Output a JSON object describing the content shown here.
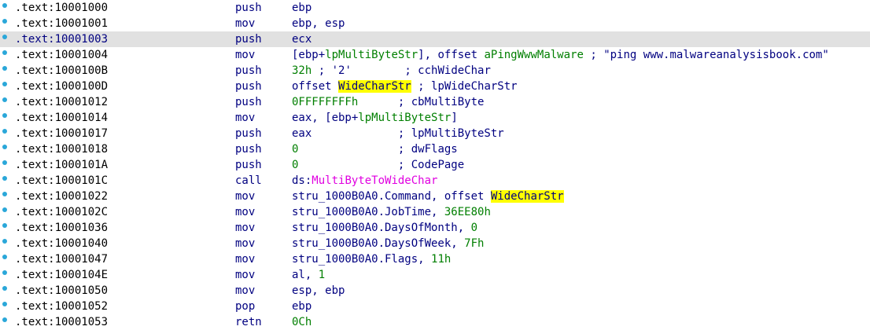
{
  "rows": [
    {
      "address": ".text:10001000",
      "mnemonic": "push",
      "operands": [
        {
          "text": "ebp",
          "cls": ""
        }
      ]
    },
    {
      "address": ".text:10001001",
      "mnemonic": "mov",
      "operands": [
        {
          "text": "ebp, esp",
          "cls": ""
        }
      ]
    },
    {
      "address": ".text:10001003",
      "mnemonic": "push",
      "selected": true,
      "operands": [
        {
          "text": "ecx",
          "cls": ""
        }
      ]
    },
    {
      "address": ".text:10001004",
      "mnemonic": "mov",
      "operands": [
        {
          "text": "[ebp+",
          "cls": ""
        },
        {
          "text": "lpMultiByteStr",
          "cls": "lbl"
        },
        {
          "text": "], offset ",
          "cls": ""
        },
        {
          "text": "aPingWwwMalware",
          "cls": "lbl"
        },
        {
          "text": " ; ",
          "cls": ""
        },
        {
          "text": "\"ping www.malwareanalysisbook.com\"",
          "cls": "str"
        }
      ]
    },
    {
      "address": ".text:1000100B",
      "mnemonic": "push",
      "operands": [
        {
          "text": "32h",
          "cls": "lbl"
        },
        {
          "text": " ; ",
          "cls": ""
        },
        {
          "text": "'2'",
          "cls": "str"
        },
        {
          "text": "        ; cchWideChar",
          "cls": ""
        }
      ]
    },
    {
      "address": ".text:1000100D",
      "mnemonic": "push",
      "operands": [
        {
          "text": "offset ",
          "cls": ""
        },
        {
          "text": "WideCharStr",
          "cls": "hl"
        },
        {
          "text": " ; lpWideCharStr",
          "cls": ""
        }
      ]
    },
    {
      "address": ".text:10001012",
      "mnemonic": "push",
      "operands": [
        {
          "text": "0FFFFFFFFh",
          "cls": "lbl"
        },
        {
          "text": "      ; cbMultiByte",
          "cls": ""
        }
      ]
    },
    {
      "address": ".text:10001014",
      "mnemonic": "mov",
      "operands": [
        {
          "text": "eax, [ebp+",
          "cls": ""
        },
        {
          "text": "lpMultiByteStr",
          "cls": "lbl"
        },
        {
          "text": "]",
          "cls": ""
        }
      ]
    },
    {
      "address": ".text:10001017",
      "mnemonic": "push",
      "operands": [
        {
          "text": "eax             ; lpMultiByteStr",
          "cls": ""
        }
      ]
    },
    {
      "address": ".text:10001018",
      "mnemonic": "push",
      "operands": [
        {
          "text": "0",
          "cls": "lbl"
        },
        {
          "text": "               ; dwFlags",
          "cls": ""
        }
      ]
    },
    {
      "address": ".text:1000101A",
      "mnemonic": "push",
      "operands": [
        {
          "text": "0",
          "cls": "lbl"
        },
        {
          "text": "               ; CodePage",
          "cls": ""
        }
      ]
    },
    {
      "address": ".text:1000101C",
      "mnemonic": "call",
      "operands": [
        {
          "text": "ds:",
          "cls": ""
        },
        {
          "text": "MultiByteToWideChar",
          "cls": "imp"
        }
      ]
    },
    {
      "address": ".text:10001022",
      "mnemonic": "mov",
      "operands": [
        {
          "text": "stru_1000B0A0.Command, offset ",
          "cls": ""
        },
        {
          "text": "WideCharStr",
          "cls": "hl"
        }
      ]
    },
    {
      "address": ".text:1000102C",
      "mnemonic": "mov",
      "operands": [
        {
          "text": "stru_1000B0A0.JobTime, ",
          "cls": ""
        },
        {
          "text": "36EE80h",
          "cls": "lbl"
        }
      ]
    },
    {
      "address": ".text:10001036",
      "mnemonic": "mov",
      "operands": [
        {
          "text": "stru_1000B0A0.DaysOfMonth, ",
          "cls": ""
        },
        {
          "text": "0",
          "cls": "lbl"
        }
      ]
    },
    {
      "address": ".text:10001040",
      "mnemonic": "mov",
      "operands": [
        {
          "text": "stru_1000B0A0.DaysOfWeek, ",
          "cls": ""
        },
        {
          "text": "7Fh",
          "cls": "lbl"
        }
      ]
    },
    {
      "address": ".text:10001047",
      "mnemonic": "mov",
      "operands": [
        {
          "text": "stru_1000B0A0.Flags, ",
          "cls": ""
        },
        {
          "text": "11h",
          "cls": "lbl"
        }
      ]
    },
    {
      "address": ".text:1000104E",
      "mnemonic": "mov",
      "operands": [
        {
          "text": "al, ",
          "cls": ""
        },
        {
          "text": "1",
          "cls": "lbl"
        }
      ]
    },
    {
      "address": ".text:10001050",
      "mnemonic": "mov",
      "operands": [
        {
          "text": "esp, ebp",
          "cls": ""
        }
      ]
    },
    {
      "address": ".text:10001052",
      "mnemonic": "pop",
      "operands": [
        {
          "text": "ebp",
          "cls": ""
        }
      ]
    },
    {
      "address": ".text:10001053",
      "mnemonic": "retn",
      "operands": [
        {
          "text": "0Ch",
          "cls": "lbl"
        }
      ]
    }
  ],
  "colors": {
    "background": "#ffffff",
    "selected_row": "#e1e1e1",
    "address": "#000000",
    "instruction": "#000080",
    "number_label": "#007f00",
    "import_name": "#e000e0",
    "highlight": "#ffff00",
    "row_marker": "#2aa7d9"
  }
}
